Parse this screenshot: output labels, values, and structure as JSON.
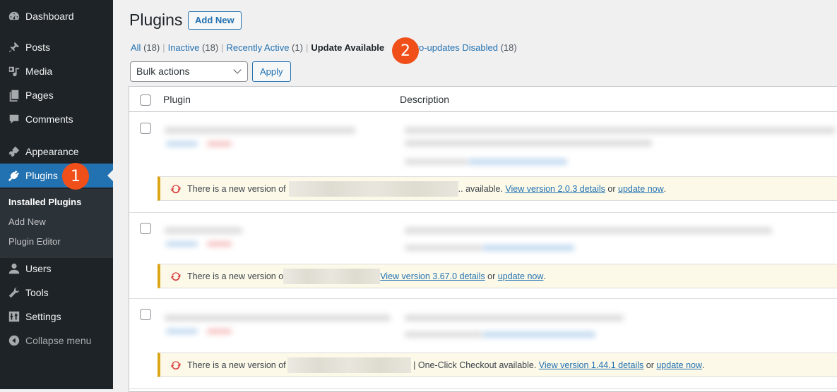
{
  "sidebar": {
    "items": [
      {
        "label": "Dashboard",
        "icon": "dashboard-icon"
      },
      {
        "label": "Posts",
        "icon": "pin-icon"
      },
      {
        "label": "Media",
        "icon": "media-icon"
      },
      {
        "label": "Pages",
        "icon": "pages-icon"
      },
      {
        "label": "Comments",
        "icon": "comment-icon"
      },
      {
        "label": "Appearance",
        "icon": "paintbrush-icon"
      },
      {
        "label": "Plugins",
        "icon": "plugin-icon",
        "active": true
      },
      {
        "label": "Users",
        "icon": "user-icon"
      },
      {
        "label": "Tools",
        "icon": "wrench-icon"
      },
      {
        "label": "Settings",
        "icon": "settings-icon"
      },
      {
        "label": "Collapse menu",
        "icon": "collapse-icon"
      }
    ],
    "submenu": [
      "Installed Plugins",
      "Add New",
      "Plugin Editor"
    ]
  },
  "annotations": {
    "badge1": "1",
    "badge2": "2",
    "badge_color": "#f04f1a"
  },
  "header": {
    "title": "Plugins",
    "add_new": "Add New"
  },
  "filters": [
    {
      "label": "All",
      "count": "(18)"
    },
    {
      "label": "Inactive",
      "count": "(18)"
    },
    {
      "label": "Recently Active",
      "count": "(1)"
    },
    {
      "label": "Update Available",
      "count": "",
      "current": true
    },
    {
      "label": "uto-updates Disabled",
      "count": "(18)"
    }
  ],
  "bulk": {
    "select_value": "Bulk actions",
    "apply": "Apply"
  },
  "table": {
    "columns": [
      "Plugin",
      "Description"
    ],
    "notices": [
      {
        "prefix": "There is a new version of",
        "middle": ".. available.",
        "link": "View version 2.0.3 details",
        "or": "or",
        "update": "update now",
        "end": "."
      },
      {
        "prefix": "There is a new version o",
        "middle": "",
        "link": "View version 3.67.0 details",
        "or": "or",
        "update": "update now",
        "end": "."
      },
      {
        "prefix": "There is a new version of",
        "middle": "| One-Click Checkout available.",
        "link": "View version 1.44.1 details",
        "or": "or",
        "update": "update now",
        "end": "."
      }
    ]
  },
  "colors": {
    "accent": "#2271b1",
    "sidebar_bg": "#1d2327",
    "notice_border": "#dba617",
    "notice_bg": "#fcf9e8",
    "update_icon": "#d63638"
  }
}
